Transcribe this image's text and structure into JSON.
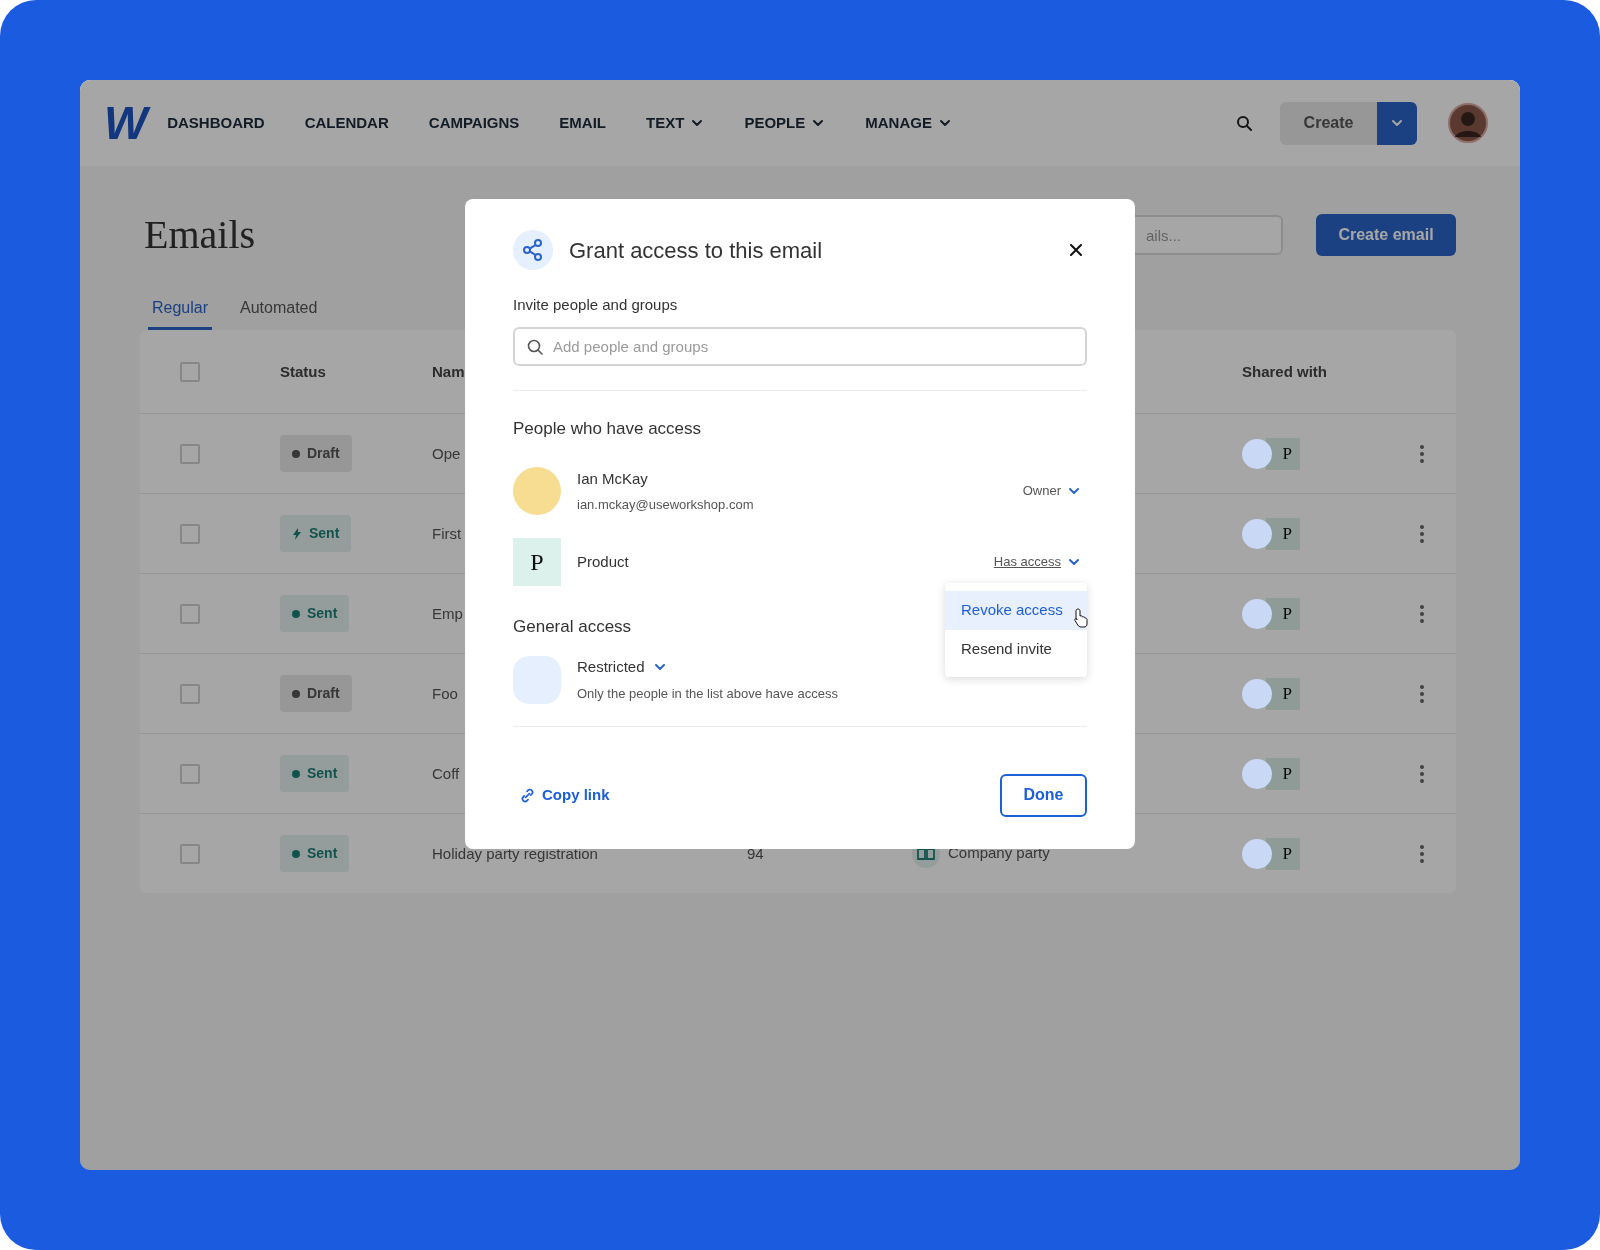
{
  "nav": {
    "logo": "W",
    "items": [
      {
        "label": "DASHBOARD",
        "has_menu": false
      },
      {
        "label": "CALENDAR",
        "has_menu": false
      },
      {
        "label": "CAMPAIGNS",
        "has_menu": false
      },
      {
        "label": "EMAIL",
        "has_menu": false
      },
      {
        "label": "TEXT",
        "has_menu": true
      },
      {
        "label": "PEOPLE",
        "has_menu": true
      },
      {
        "label": "MANAGE",
        "has_menu": true
      }
    ],
    "create_button": "Create"
  },
  "page": {
    "title": "Emails",
    "search": {
      "placeholder": "ails..."
    },
    "create_button": "Create email",
    "tabs": [
      {
        "label": "Regular",
        "selected": true
      },
      {
        "label": "Automated",
        "selected": false
      }
    ]
  },
  "table": {
    "select_all_checked": false,
    "columns": [
      "Status",
      "Nam",
      "Shared with"
    ],
    "rows": [
      {
        "checked": false,
        "status": {
          "label": "Draft",
          "kind": "draft",
          "bolt": false
        },
        "name": "Ope",
        "shared_group": "P"
      },
      {
        "checked": false,
        "status": {
          "label": "Sent",
          "kind": "sent",
          "bolt": true
        },
        "name": "First",
        "shared_group": "P"
      },
      {
        "checked": false,
        "status": {
          "label": "Sent",
          "kind": "sent",
          "bolt": false
        },
        "name": "Emp",
        "shared_group": "P"
      },
      {
        "checked": false,
        "status": {
          "label": "Draft",
          "kind": "draft",
          "bolt": false
        },
        "name": "Foo",
        "shared_group": "P"
      },
      {
        "checked": false,
        "status": {
          "label": "Sent",
          "kind": "sent",
          "bolt": false
        },
        "name": "Coff",
        "shared_group": "P"
      },
      {
        "checked": false,
        "status": {
          "label": "Sent",
          "kind": "sent",
          "bolt": false
        },
        "name": "Holiday party registration",
        "count": "94",
        "list": "Company party",
        "shared_group": "P"
      }
    ]
  },
  "dialog": {
    "title": "Grant access to this email",
    "invite_label": "Invite people and groups",
    "invite_field": {
      "placeholder": "Add people and groups"
    },
    "people_heading": "People who have access",
    "people": [
      {
        "kind": "person",
        "name": "Ian McKay",
        "email": "ian.mckay@useworkshop.com",
        "role": "Owner",
        "menu_open": false
      },
      {
        "kind": "group",
        "initial": "P",
        "name": "Product",
        "role": "Has access",
        "menu_open": true
      }
    ],
    "role_menu": [
      {
        "label": "Revoke access",
        "selected": true
      },
      {
        "label": "Resend invite",
        "selected": false
      }
    ],
    "general_heading": "General access",
    "general_access": {
      "label": "Restricted",
      "description": "Only the people in the list above have access"
    },
    "copy_link": "Copy link",
    "done_button": "Done"
  }
}
